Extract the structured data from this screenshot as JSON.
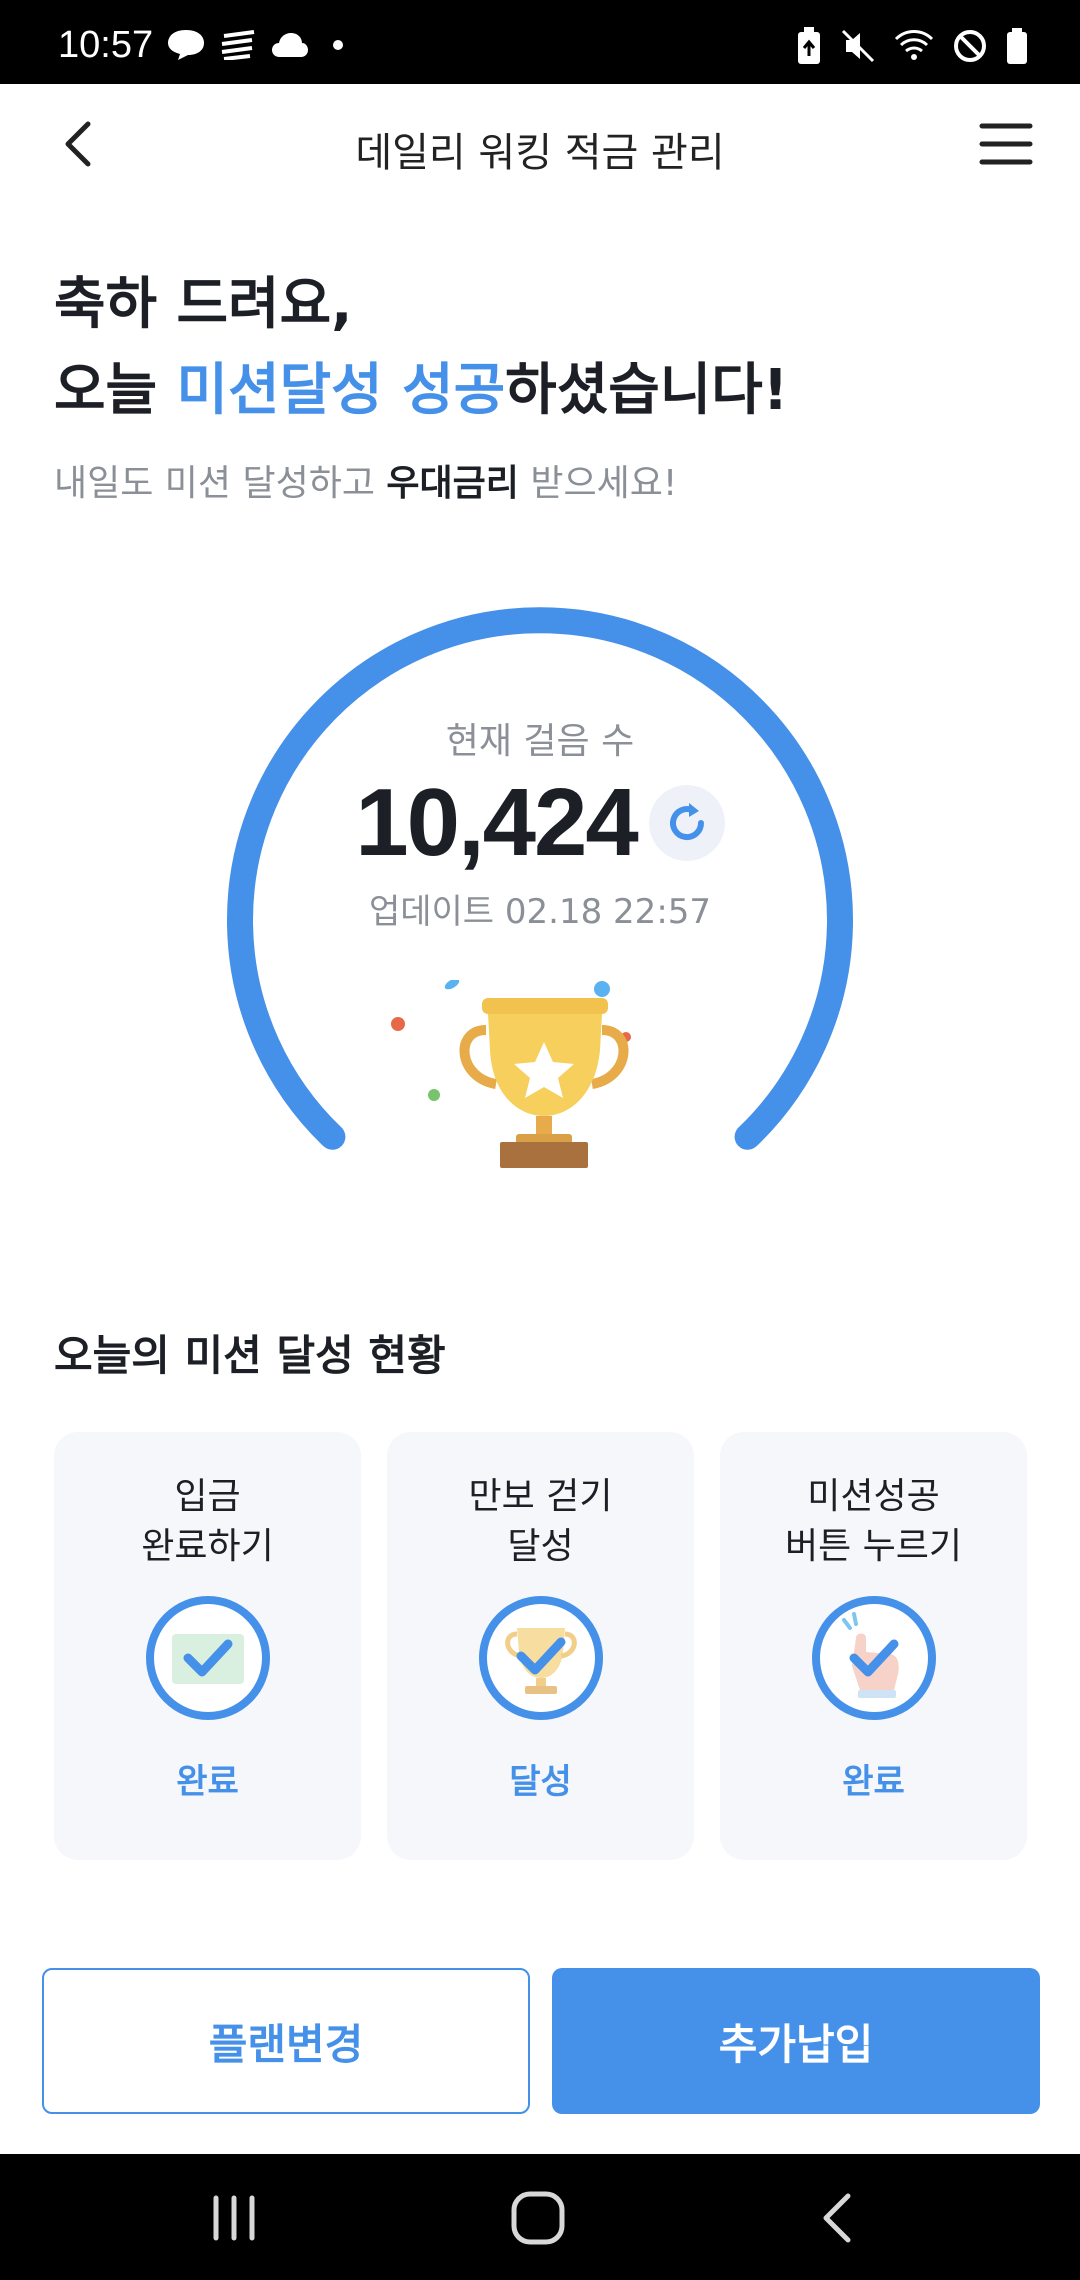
{
  "status_bar": {
    "time": "10:57",
    "left_icons": [
      "chat-bubble-icon",
      "stripes-icon",
      "cloud-icon",
      "dot-icon"
    ],
    "right_icons": [
      "battery-saver-icon",
      "mute-icon",
      "wifi-icon",
      "blocked-icon",
      "battery-icon"
    ]
  },
  "header": {
    "title": "데일리 워킹 적금 관리",
    "back_icon": "chevron-left-icon",
    "menu_icon": "hamburger-icon"
  },
  "hero": {
    "line1": "축하 드려요,",
    "line2_prefix": "오늘 ",
    "line2_accent": "미션달성 성공",
    "line2_suffix": "하셨습니다!",
    "sub_prefix": "내일도 미션 달성하고 ",
    "sub_strong": "우대금리",
    "sub_suffix": " 받으세요!"
  },
  "gauge": {
    "label": "현재 걸음 수",
    "value": "10,424",
    "update_label": "업데이트",
    "update_time": "02.18 22:57",
    "progress": 1.0,
    "color": "#4590e8"
  },
  "missions": {
    "title": "오늘의 미션 달성 현황",
    "items": [
      {
        "title_line1": "입금",
        "title_line2": "완료하기",
        "status": "완료",
        "icon": "deposit-check-icon"
      },
      {
        "title_line1": "만보 걷기",
        "title_line2": "달성",
        "status": "달성",
        "icon": "trophy-check-icon"
      },
      {
        "title_line1": "미션성공",
        "title_line2": "버튼 누르기",
        "status": "완료",
        "icon": "tap-check-icon"
      }
    ]
  },
  "buttons": {
    "plan_change": "플랜변경",
    "extra_deposit": "추가납입"
  },
  "colors": {
    "accent": "#4590e8",
    "card_bg": "#f5f7fb",
    "sub_text": "#8b8f97"
  }
}
